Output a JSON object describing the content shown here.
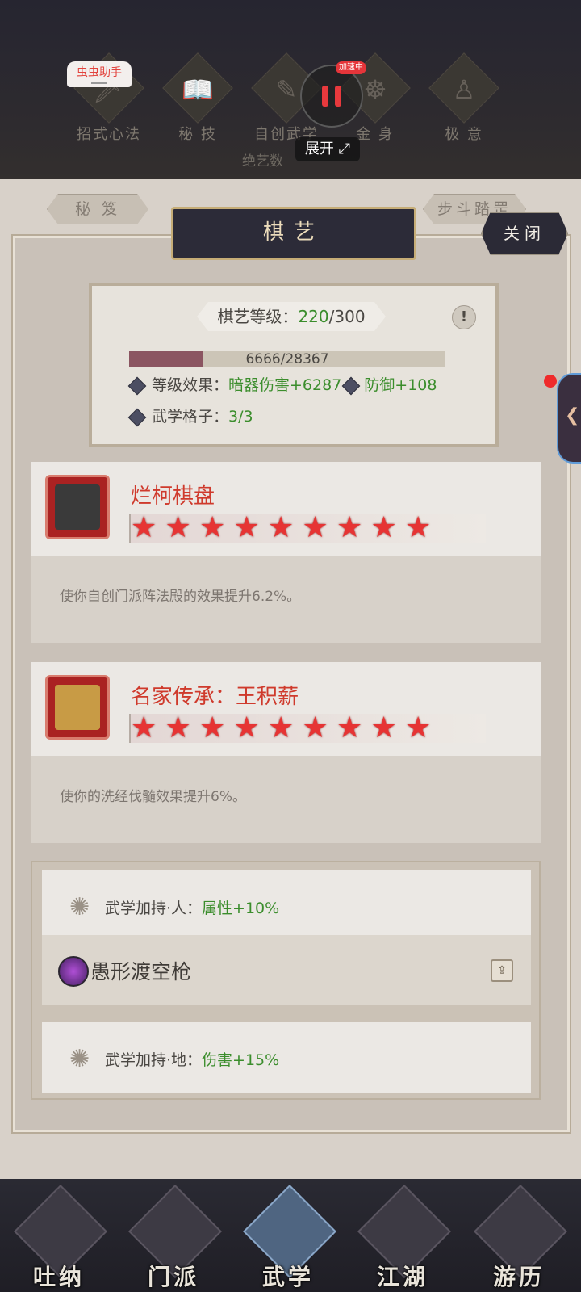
{
  "top": {
    "tabs": [
      {
        "label": "招式心法",
        "icon": "sword-icon"
      },
      {
        "label": "秘 技",
        "icon": "book-icon"
      },
      {
        "label": "自创武学",
        "icon": "scroll-brush-icon"
      },
      {
        "label": "金 身",
        "icon": "meditate-icon"
      },
      {
        "label": "极 意",
        "icon": "martial-pose-icon"
      }
    ],
    "subtitle": "绝艺数",
    "helper_label": "虫虫助手",
    "speed_tag": "加速中",
    "expand_label": "展开"
  },
  "subtabs": [
    "秘 笈",
    "步斗踏罡"
  ],
  "modal": {
    "title": "棋艺",
    "close_label": "关闭",
    "level_label": "棋艺等级：",
    "level_value": "220",
    "level_max": "/300",
    "exp_text": "6666/28367",
    "exp_fraction": 0.235,
    "effect_label": "等级效果：",
    "effect_1": "暗器伤害+6287",
    "effect_2": "防御+108",
    "slot_label": "武学格子：",
    "slot_value": "3/3"
  },
  "items": [
    {
      "name": "烂柯棋盘",
      "stars": 9,
      "description": "使你自创门派阵法殿的效果提升6.2%。",
      "icon": "go-board-icon"
    },
    {
      "name": "名家传承：王积薪",
      "stars": 9,
      "description": "使你的洗经伐髓效果提升6%。",
      "icon": "scroll-icon"
    }
  ],
  "bonuses": {
    "row1_label": "武学加持·人：",
    "row1_value": "属性+10%",
    "skill_name": "愚形渡空枪",
    "row2_label": "武学加持·地：",
    "row2_value": "伤害+15%"
  },
  "bottom_nav": [
    "吐纳",
    "门派",
    "武学",
    "江湖",
    "游历"
  ],
  "colors": {
    "accent_red": "#cf3a2c",
    "value_green": "#3b8d2c",
    "title_gold": "#c6ad77"
  }
}
